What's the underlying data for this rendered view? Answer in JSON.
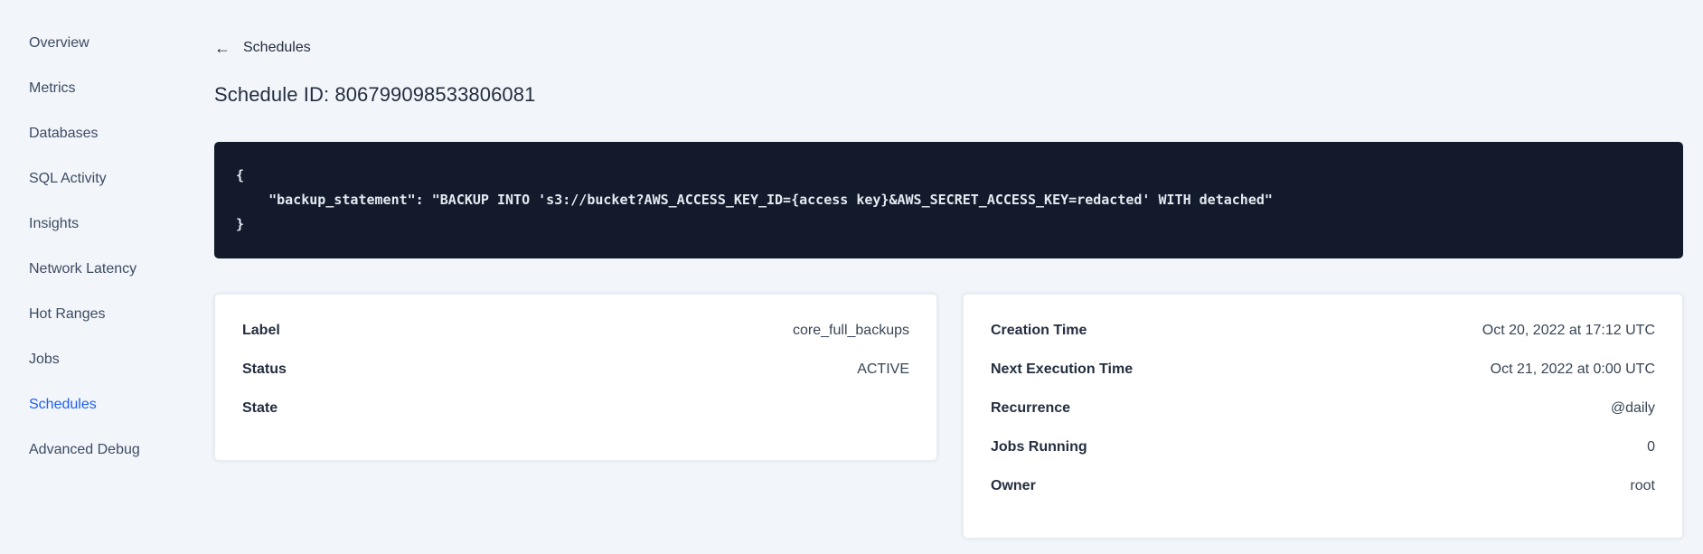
{
  "sidebar": {
    "items": [
      {
        "label": "Overview",
        "active": false
      },
      {
        "label": "Metrics",
        "active": false
      },
      {
        "label": "Databases",
        "active": false
      },
      {
        "label": "SQL Activity",
        "active": false
      },
      {
        "label": "Insights",
        "active": false
      },
      {
        "label": "Network Latency",
        "active": false
      },
      {
        "label": "Hot Ranges",
        "active": false
      },
      {
        "label": "Jobs",
        "active": false
      },
      {
        "label": "Schedules",
        "active": true
      },
      {
        "label": "Advanced Debug",
        "active": false
      }
    ]
  },
  "header": {
    "back_icon": "←",
    "back_label": "Schedules",
    "title": "Schedule ID: 806799098533806081"
  },
  "code_block": {
    "lines": [
      "{",
      "    \"backup_statement\": \"BACKUP INTO 's3://bucket?AWS_ACCESS_KEY_ID={access key}&AWS_SECRET_ACCESS_KEY=redacted' WITH detached\"",
      "}"
    ]
  },
  "details_card": {
    "rows": [
      {
        "label": "Label",
        "value": "core_full_backups"
      },
      {
        "label": "Status",
        "value": "ACTIVE"
      },
      {
        "label": "State",
        "value": ""
      }
    ]
  },
  "schedule_card": {
    "rows": [
      {
        "label": "Creation Time",
        "value": "Oct 20, 2022 at 17:12 UTC"
      },
      {
        "label": "Next Execution Time",
        "value": "Oct 21, 2022 at 0:00 UTC"
      },
      {
        "label": "Recurrence",
        "value": "@daily"
      },
      {
        "label": "Jobs Running",
        "value": "0"
      },
      {
        "label": "Owner",
        "value": "root"
      }
    ]
  },
  "colors": {
    "accent": "#1f5ef5",
    "page_bg": "#f2f5f9",
    "code_bg": "#121a2c",
    "code_text": "#e5eaf1"
  }
}
